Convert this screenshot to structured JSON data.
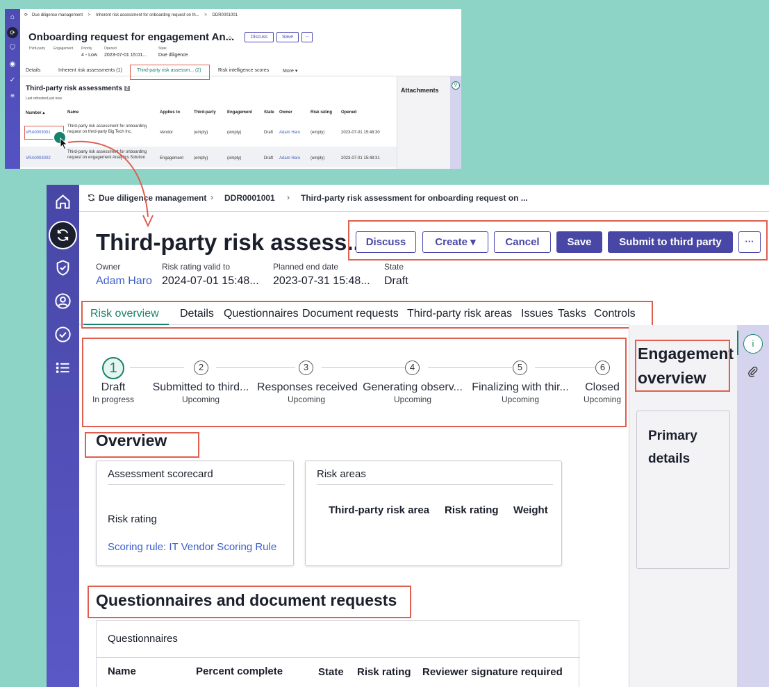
{
  "small": {
    "breadcrumb": [
      "Due diligence management",
      ">",
      "Inherent risk assessment for onboarding request on th...",
      ">",
      "DDR0001001"
    ],
    "title": "Onboarding request for engagement An...",
    "buttons": {
      "discuss": "Discuss",
      "save": "Save",
      "more": "..."
    },
    "fields": [
      {
        "label": "Third-party",
        "value": ""
      },
      {
        "label": "Engagement",
        "value": ""
      },
      {
        "label": "Priority",
        "value": "4 - Low"
      },
      {
        "label": "Opened",
        "value": "2023-07-01 15:01..."
      },
      {
        "label": "State",
        "value": "Due diligence"
      }
    ],
    "tabs": [
      "Details",
      "Inherent risk assessments (1)",
      "Third-party risk assessm...  (2)",
      "Risk intelligence scores",
      "More ▾"
    ],
    "section_title": "Third-party risk assessments",
    "section_count": "2",
    "refreshed": "Last refreshed just now.",
    "columns": [
      "Number ▴",
      "Name",
      "Applies to",
      "Third-party",
      "Engagement",
      "State",
      "Owner",
      "Risk rating",
      "Opened"
    ],
    "rows": [
      {
        "number": "VRA0003001",
        "name": "Third-party risk assessment for onboarding request on third-party Big Tech Inc.",
        "applies": "Vendor",
        "third_party": "(empty)",
        "engagement": "(empty)",
        "state": "Draft",
        "owner": "Adam Haro",
        "risk": "(empty)",
        "opened": "2023-07-01 15:48:30"
      },
      {
        "number": "VRA0003002",
        "name": "Third-party risk assessment for onboarding request on engagement Analytics Solution",
        "applies": "Engagement",
        "third_party": "(empty)",
        "engagement": "(empty)",
        "state": "Draft",
        "owner": "Adam Haro",
        "risk": "(empty)",
        "opened": "2023-07-01 15:48:31"
      }
    ],
    "side_title": "Attachments"
  },
  "big": {
    "breadcrumb": [
      "Due diligence management",
      "DDR0001001",
      "Third-party risk assessment for onboarding request on ..."
    ],
    "title": "Third-party risk assess...",
    "buttons": {
      "discuss": "Discuss",
      "create": "Create ▾",
      "cancel": "Cancel",
      "save": "Save",
      "submit": "Submit to third party",
      "more": "···"
    },
    "fields": [
      {
        "label": "Owner",
        "value": "Adam Haro"
      },
      {
        "label": "Risk rating valid to",
        "value": "2024-07-01 15:48..."
      },
      {
        "label": "Planned end date",
        "value": "2023-07-31 15:48..."
      },
      {
        "label": "State",
        "value": "Draft"
      }
    ],
    "tabs": [
      "Risk overview",
      "Details",
      "Questionnaires",
      "Document requests",
      "Third-party risk areas",
      "Issues",
      "Tasks",
      "Controls"
    ],
    "steps": [
      {
        "num": "1",
        "label": "Draft",
        "status": "In progress"
      },
      {
        "num": "2",
        "label": "Submitted to third...",
        "status": "Upcoming"
      },
      {
        "num": "3",
        "label": "Responses received",
        "status": "Upcoming"
      },
      {
        "num": "4",
        "label": "Generating observ...",
        "status": "Upcoming"
      },
      {
        "num": "5",
        "label": "Finalizing with thir...",
        "status": "Upcoming"
      },
      {
        "num": "6",
        "label": "Closed",
        "status": "Upcoming"
      }
    ],
    "overview_title": "Overview",
    "scorecard": {
      "title": "Assessment scorecard",
      "risk_label": "Risk rating",
      "scoring_rule": "Scoring rule: IT Vendor Scoring Rule"
    },
    "risk_areas": {
      "title": "Risk areas",
      "columns": [
        "Third-party risk area",
        "Risk rating",
        "Weight"
      ]
    },
    "q_section_title": "Questionnaires and document requests",
    "questionnaires": {
      "title": "Questionnaires",
      "columns": [
        "Name",
        "Percent complete",
        "State",
        "Risk rating",
        "Reviewer signature required"
      ]
    },
    "panel": {
      "title": "Engagement overview",
      "card": "Primary details"
    }
  },
  "colors": {
    "accent": "#4847a6",
    "active_tab": "#15836b",
    "link": "#3b5fc9",
    "highlight": "#e05d50",
    "background": "#8dd4c7"
  }
}
